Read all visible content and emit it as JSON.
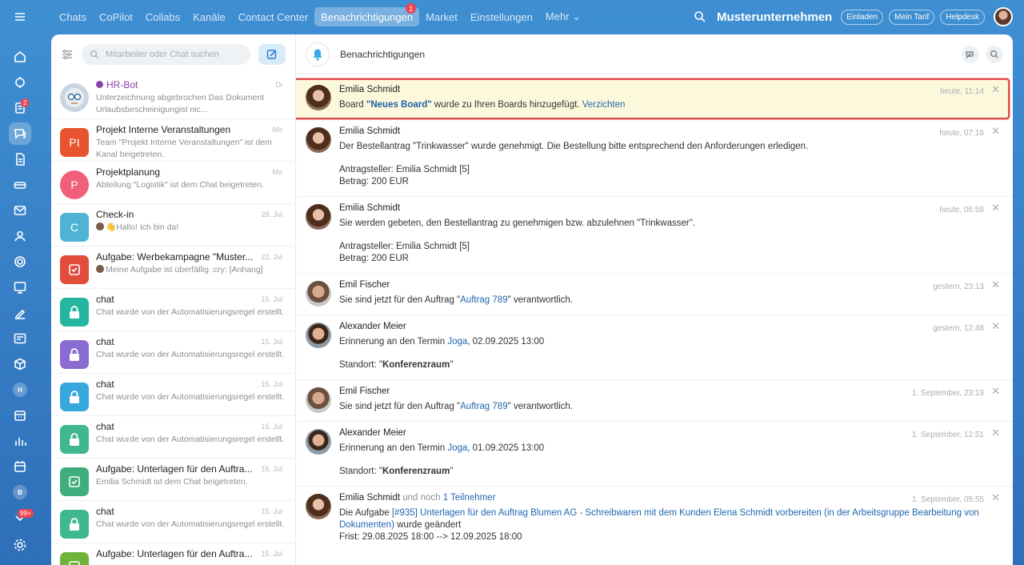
{
  "nav": {
    "items": [
      "Chats",
      "CoPilot",
      "Collabs",
      "Kanäle",
      "Contact Center",
      "Benachrichtigungen",
      "Market",
      "Einstellungen",
      "Mehr ⌄"
    ],
    "active_badge": "1"
  },
  "header": {
    "company": "Musterunternehmen",
    "invite": "Einladen",
    "plan": "Mein Tarif",
    "helpdesk": "Helpdesk"
  },
  "leftbar": {
    "badge_tasks": "2",
    "badge_more": "99+",
    "letter_h": "H",
    "letter_b": "B"
  },
  "search": {
    "placeholder": "Mitarbeiter oder Chat suchen"
  },
  "chats": [
    {
      "name": "HR-Bot",
      "sub": "Unterzeichnung abgebrochen Das Dokument Urlaubsbescheinigungist nic...",
      "date": "Di",
      "avatar": "",
      "color": "#c7cdd6"
    },
    {
      "name": "Projekt Interne Veranstaltungen",
      "sub": "Team \"Projekt Interne Veranstaltungen\" ist dem Kanal beigetreten.",
      "date": "Mo",
      "avatar": "PI",
      "color": "#e8542f"
    },
    {
      "name": "Projektplanung",
      "sub": "Abteilung \"Logistik\" ist dem Chat beigetreten.",
      "date": "Mo",
      "avatar": "P",
      "color": "#f0607a"
    },
    {
      "name": "Check-in",
      "sub": "👋Hallo! Ich bin da!",
      "date": "28. Jul",
      "avatar": "C",
      "color": "#4fb3d6"
    },
    {
      "name": "Aufgabe: Werbekampagne \"Muster...",
      "sub": "Meine Aufgabe ist überfällig :cry: [Anhang]",
      "date": "22. Jul",
      "avatar": "",
      "color": "#e24c3a"
    },
    {
      "name": "chat",
      "sub": "Chat wurde von der Automatisierungsregel erstellt.",
      "date": "15. Jul",
      "avatar": "",
      "color": "#26b5a0"
    },
    {
      "name": "chat",
      "sub": "Chat wurde von der Automatisierungsregel erstellt.",
      "date": "15. Jul",
      "avatar": "",
      "color": "#8a6bd1"
    },
    {
      "name": "chat",
      "sub": "Chat wurde von der Automatisierungsregel erstellt.",
      "date": "15. Jul",
      "avatar": "",
      "color": "#36a8de"
    },
    {
      "name": "chat",
      "sub": "Chat wurde von der Automatisierungsregel erstellt.",
      "date": "15. Jul",
      "avatar": "",
      "color": "#3fb78f"
    },
    {
      "name": "Aufgabe: Unterlagen für den Auftra...",
      "sub": "Emilia Schmidt ist dem Chat beigetreten.",
      "date": "15. Jul",
      "avatar": "",
      "color": "#3fae7d"
    },
    {
      "name": "chat",
      "sub": "Chat wurde von der Automatisierungsregel erstellt.",
      "date": "15. Jul",
      "avatar": "",
      "color": "#3fb78f"
    },
    {
      "name": "Aufgabe: Unterlagen für den Auftra...",
      "sub": "",
      "date": "15. Jul",
      "avatar": "",
      "color": "#6fb33a"
    }
  ],
  "notifications": {
    "title": "Benachrichtigungen",
    "items": [
      {
        "name": "Emilia Schmidt",
        "time": "heute, 11:14",
        "t1": "Board ",
        "b1": "\"Neues Board\"",
        "t2": " wurde zu Ihren Boards hinzugefügt. ",
        "link": "Verzichten"
      },
      {
        "name": "Emilia Schmidt",
        "time": "heute, 07:16",
        "l1": "Der Bestellantrag \"Trinkwasser\" wurde genehmigt. Die Bestellung bitte entsprechend den Anforderungen erledigen.",
        "l2": "Antragsteller: Emilia Schmidt [5]",
        "l3": "Betrag: 200 EUR"
      },
      {
        "name": "Emilia Schmidt",
        "time": "heute, 06:58",
        "l1": "Sie werden gebeten, den Bestellantrag zu genehmigen bzw. abzulehnen \"Trinkwasser\".",
        "l2": "Antragsteller: Emilia Schmidt [5]",
        "l3": "Betrag: 200 EUR"
      },
      {
        "name": "Emil Fischer",
        "time": "gestern, 23:13",
        "p1": "Sie sind jetzt für den Auftrag \"",
        "link": "Auftrag 789",
        "p2": "\" verantwortlich."
      },
      {
        "name": "Alexander Meier",
        "time": "gestern, 12:48",
        "p1": "Erinnerung an den Termin ",
        "link": "Joga",
        "p2": ", 02.09.2025 13:00",
        "loc1": "Standort: \"",
        "loc": "Konferenzraum",
        "loc2": "\""
      },
      {
        "name": "Emil Fischer",
        "time": "1. September, 23:19",
        "p1": "Sie sind jetzt für den Auftrag \"",
        "link": "Auftrag 789",
        "p2": "\" verantwortlich."
      },
      {
        "name": "Alexander Meier",
        "time": "1. September, 12:51",
        "p1": "Erinnerung an den Termin ",
        "link": "Joga",
        "p2": ", 01.09.2025 13:00",
        "loc1": "Standort: \"",
        "loc": "Konferenzraum",
        "loc2": "\""
      },
      {
        "name": "Emilia Schmidt",
        "extra": " und noch ",
        "extra_link": "1 Teilnehmer",
        "time": "1. September, 05:55",
        "p1": "Die Aufgabe ",
        "link": "[#935] Unterlagen für den Auftrag Blumen AG - Schreibwaren mit dem Kunden Elena Schmidt vorbereiten (in der Arbeitsgruppe Bearbeitung von Dokumenten)",
        "p2": " wurde geändert",
        "l2": "Frist: 29.08.2025 18:00 --> 12.09.2025 18:00"
      }
    ]
  },
  "colors": {
    "accent": "#2f6fb9",
    "highlight_bg": "#fcf8dc",
    "highlight_border": "#e34b4b",
    "link": "#2067b0"
  }
}
